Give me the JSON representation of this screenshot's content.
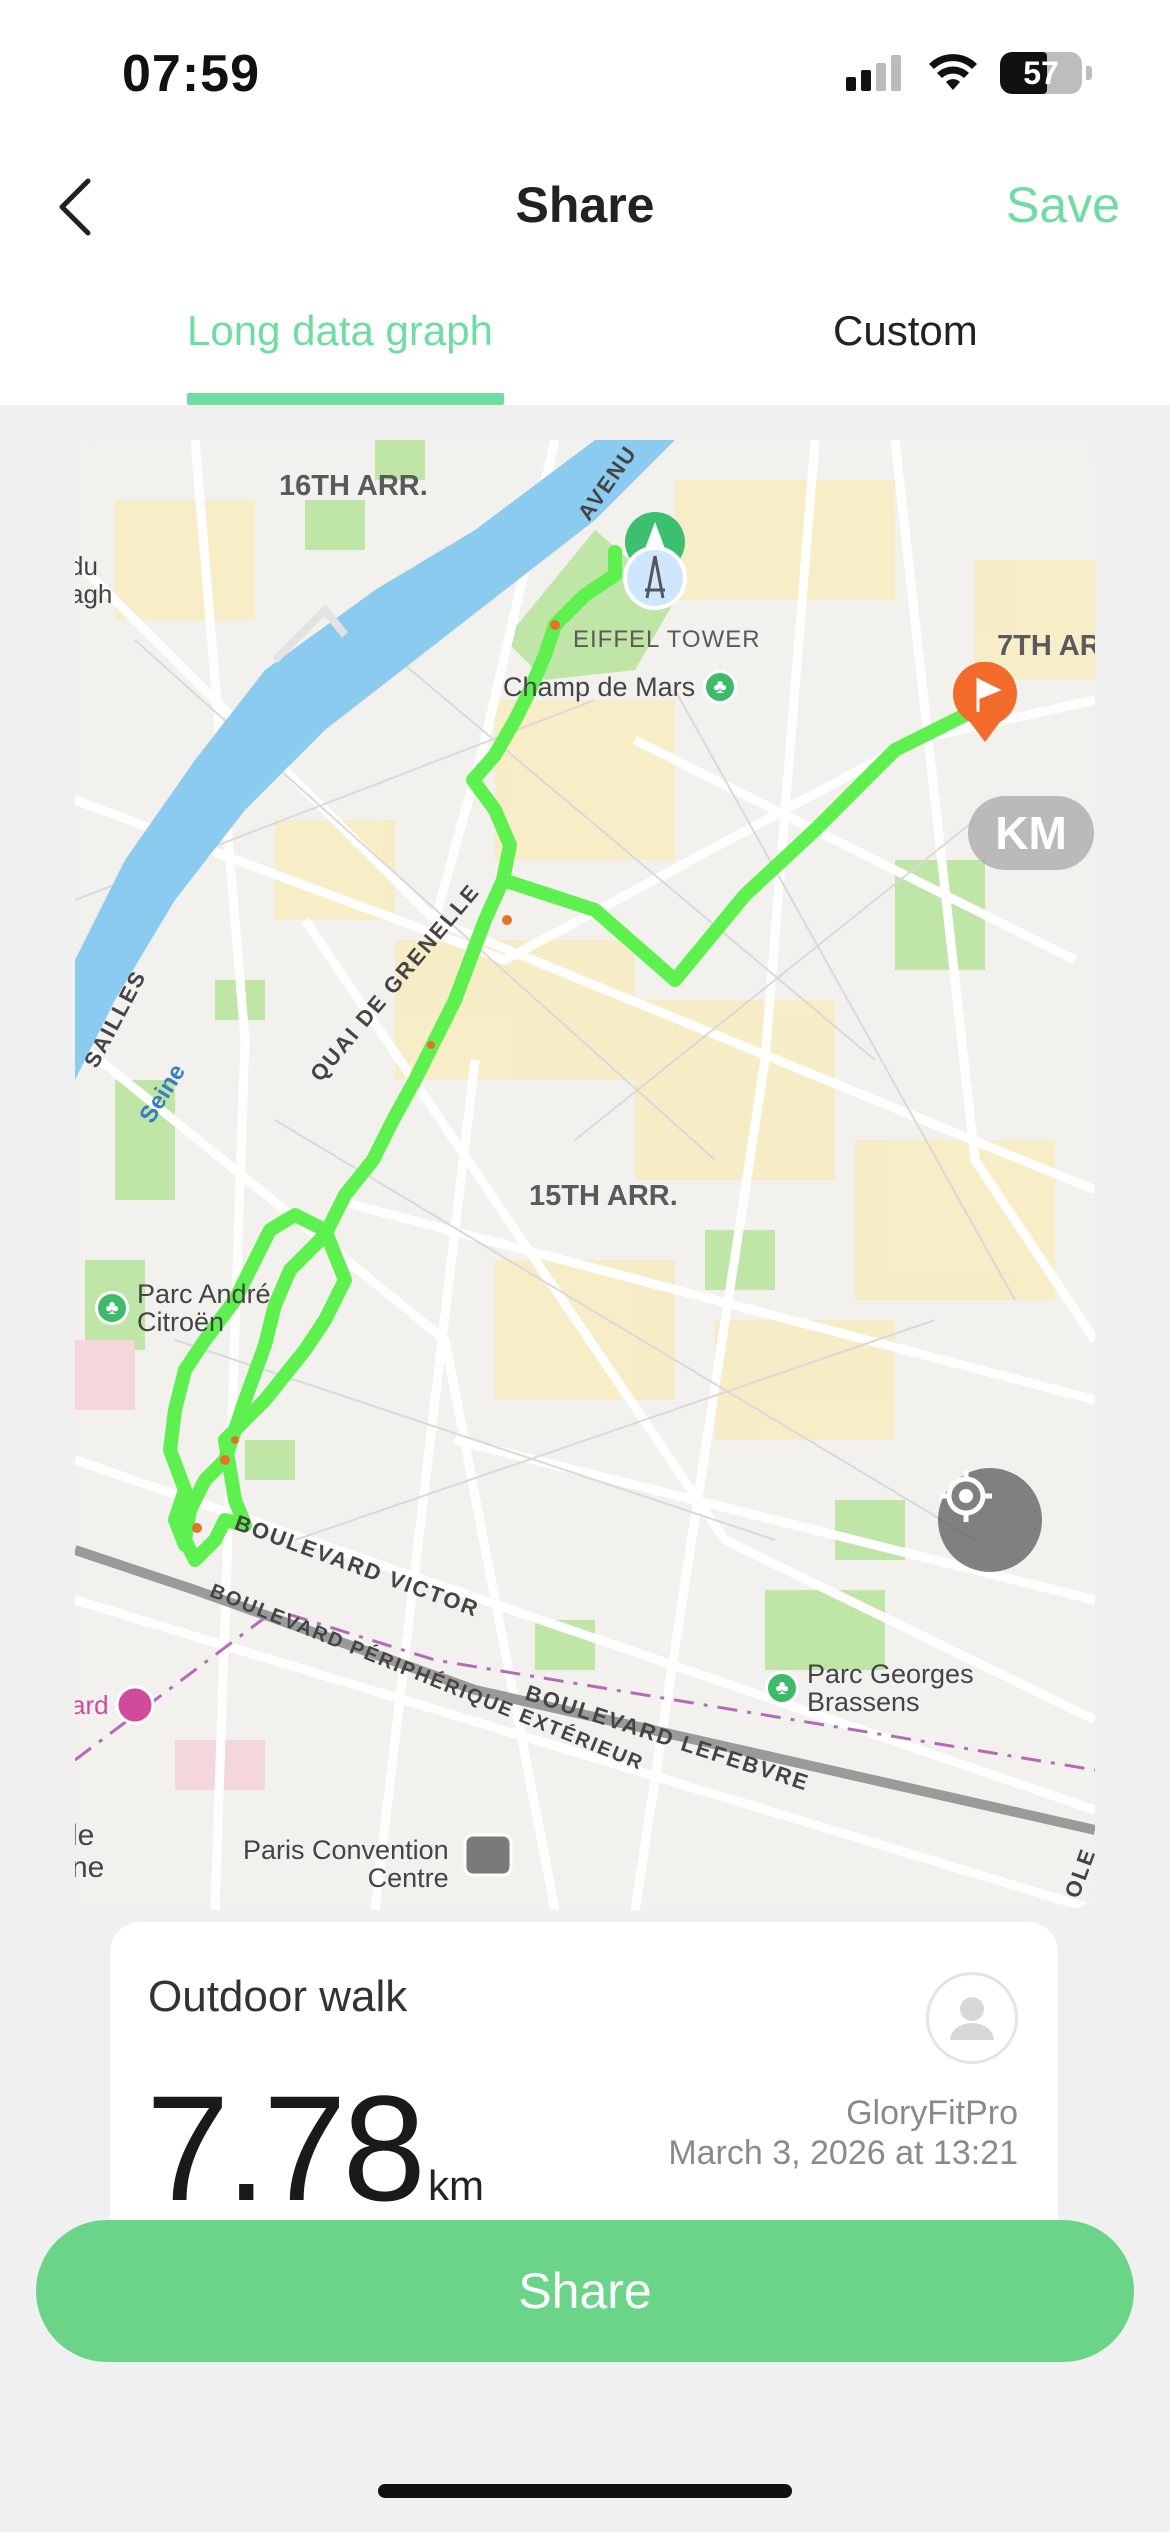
{
  "status_bar": {
    "time": "07:59",
    "battery": "57",
    "battery_level": 0.57
  },
  "nav": {
    "title": "Share",
    "save_label": "Save",
    "back_icon": "chevron-left-icon"
  },
  "tabs": [
    {
      "label": "Long data graph",
      "active": true
    },
    {
      "label": "Custom",
      "active": false
    }
  ],
  "map": {
    "labels": {
      "arr16": "16TH ARR.",
      "arr15": "15TH ARR.",
      "arr7": "7TH AR",
      "avenue": "AVENU",
      "quai": "QUAI DE GRENELLE",
      "versailles": "SAILLES",
      "seine": "Seine",
      "bd_victor": "BOULEVARD VICTOR",
      "bd_lefebvre": "BOULEVARD LEFEBVRE",
      "bd_peripherique": "BOULEVARD PÉRIPHÉRIQUE EXTÉRIEUR",
      "left_top": "du\nagh",
      "left_mid": "ard",
      "left_bottom": "le\nne",
      "right_bottom": "OLE"
    },
    "pois": {
      "eiffel": "EIFFEL TOWER",
      "champ": "Champ de Mars",
      "citroen": "Parc André\nCitroën",
      "brassens": "Parc Georges\nBrassens",
      "convention": "Paris Convention\nCentre"
    },
    "unit_badge": "KM",
    "colors": {
      "route": "#5ef04f",
      "water": "#8ccbf0",
      "park": "#bfe6a6",
      "start": "#3cbf6e",
      "finish": "#f36b2a"
    }
  },
  "summary": {
    "activity": "Outdoor walk",
    "distance": "7.78",
    "unit": "km",
    "brand": "GloryFitPro",
    "datetime": "March 3, 2026 at 13:21"
  },
  "share_label": "Share",
  "accent": "#6fdca2"
}
